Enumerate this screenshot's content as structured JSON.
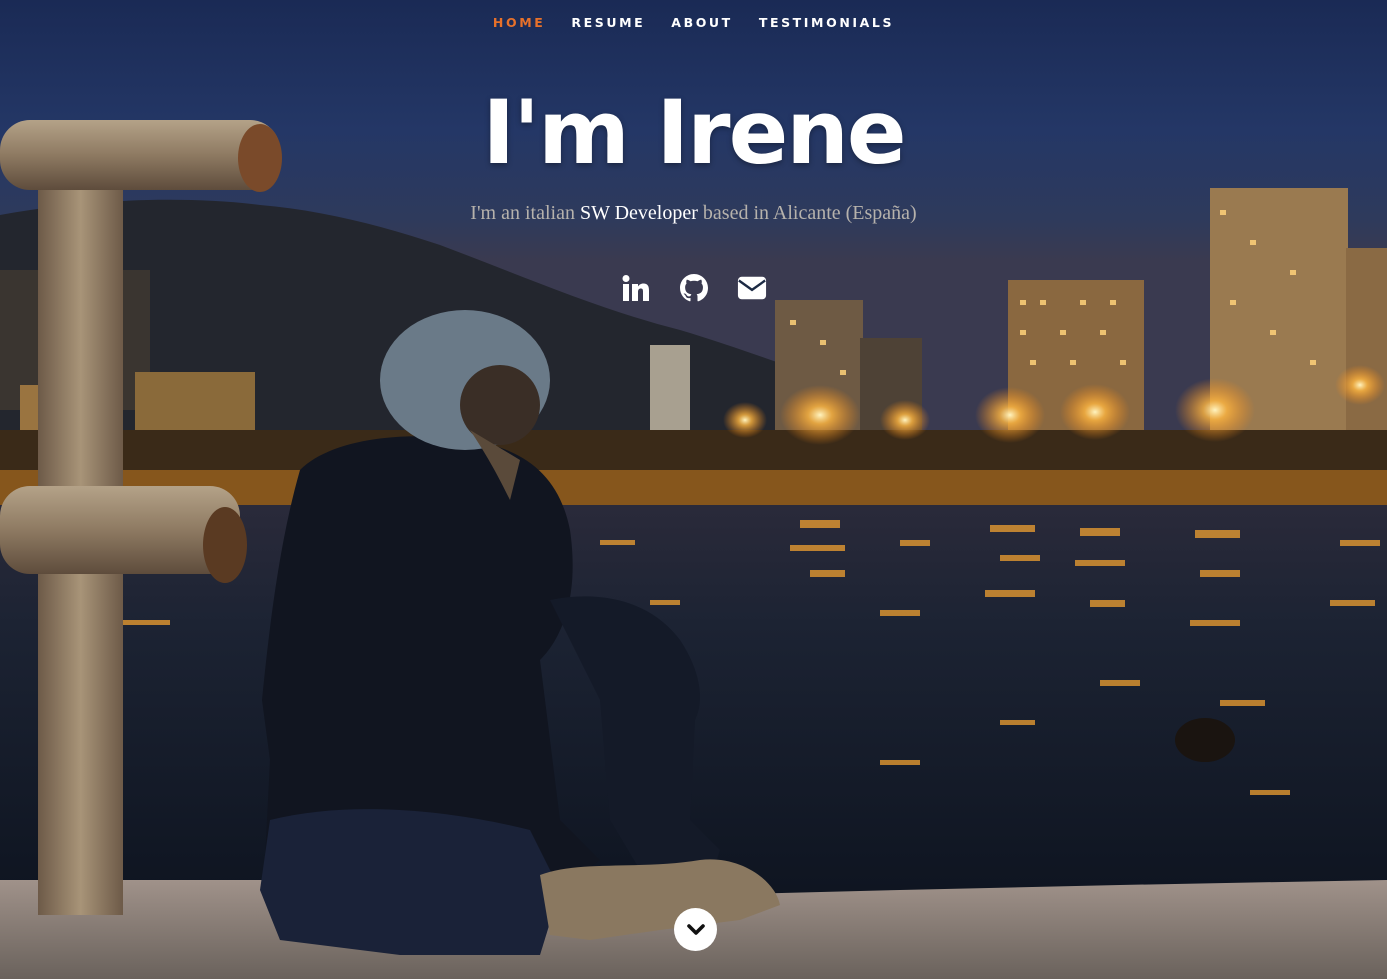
{
  "nav": {
    "items": [
      {
        "label": "HOME",
        "active": true
      },
      {
        "label": "RESUME",
        "active": false
      },
      {
        "label": "ABOUT",
        "active": false
      },
      {
        "label": "TESTIMONIALS",
        "active": false
      }
    ],
    "active_color": "#e8712a"
  },
  "hero": {
    "headline": "I'm Irene",
    "tagline_part1": "I'm an italian ",
    "tagline_strong": "SW Developer",
    "tagline_part2": " based in Alicante (España)"
  },
  "social": {
    "icons": [
      "linkedin-icon",
      "github-icon",
      "envelope-icon"
    ]
  },
  "scroll": {
    "icon": "chevron-down-icon"
  }
}
